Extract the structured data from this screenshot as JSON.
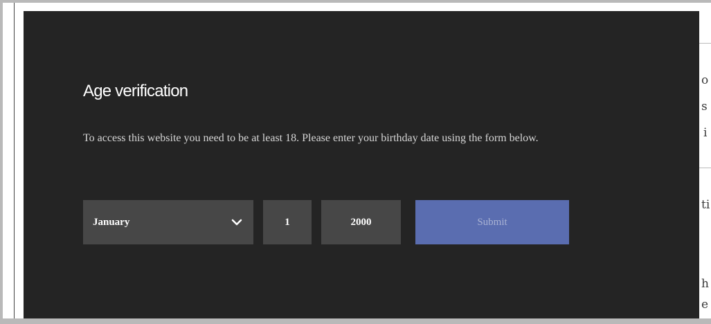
{
  "modal": {
    "title": "Age verification",
    "description": "To access this website you need to be at least 18. Please enter your birthday date using the form below."
  },
  "form": {
    "month": {
      "value": "January",
      "icon": "chevron-down-icon"
    },
    "day": {
      "value": "1"
    },
    "year": {
      "value": "2000"
    },
    "submit_label": "Submit"
  },
  "background_page": {
    "fragments": [
      "o",
      "s",
      "i",
      "ti",
      "h",
      "e"
    ]
  },
  "colors": {
    "modal_bg": "#242424",
    "field_bg": "#474747",
    "submit_bg": "#5a6db0",
    "submit_text": "#aab3d4"
  }
}
